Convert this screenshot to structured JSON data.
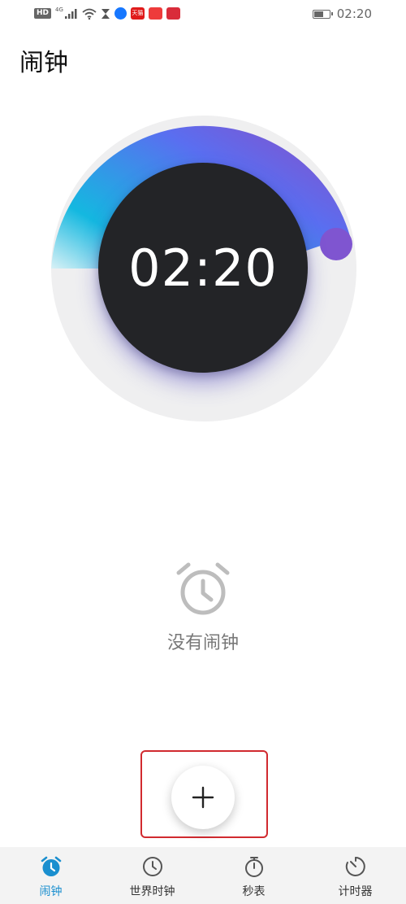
{
  "status_bar": {
    "hd": "HD",
    "network": "4G",
    "apps": [
      {
        "name": "alipay-icon",
        "text": "",
        "color": "#1677ff"
      },
      {
        "name": "tmall-icon",
        "text": "天猫",
        "color": "#e01b1b"
      },
      {
        "name": "red-app-icon",
        "text": "",
        "color": "#ee3b3b"
      },
      {
        "name": "calendar-app-icon",
        "text": "",
        "color": "#d92c3a"
      }
    ],
    "time": "02:20"
  },
  "page": {
    "title": "闹钟"
  },
  "dial": {
    "time": "02:20",
    "progress": 0.2,
    "colors": {
      "track": "#eeeeef",
      "gradient_start": "#a8e4ef",
      "gradient_mid": "#14b8e0",
      "gradient_end": "#7f55d0",
      "face": "#232427"
    }
  },
  "empty_state": {
    "icon": "alarm-clock-icon",
    "text": "没有闹钟"
  },
  "add_button": {
    "icon": "plus-icon",
    "highlight_color": "#d12a2f"
  },
  "bottom_nav": {
    "active_color": "#1a8fcf",
    "items": [
      {
        "label": "闹钟",
        "icon": "alarm-icon",
        "active": true
      },
      {
        "label": "世界时钟",
        "icon": "world-clock-icon",
        "active": false
      },
      {
        "label": "秒表",
        "icon": "stopwatch-icon",
        "active": false
      },
      {
        "label": "计时器",
        "icon": "timer-icon",
        "active": false
      }
    ]
  }
}
